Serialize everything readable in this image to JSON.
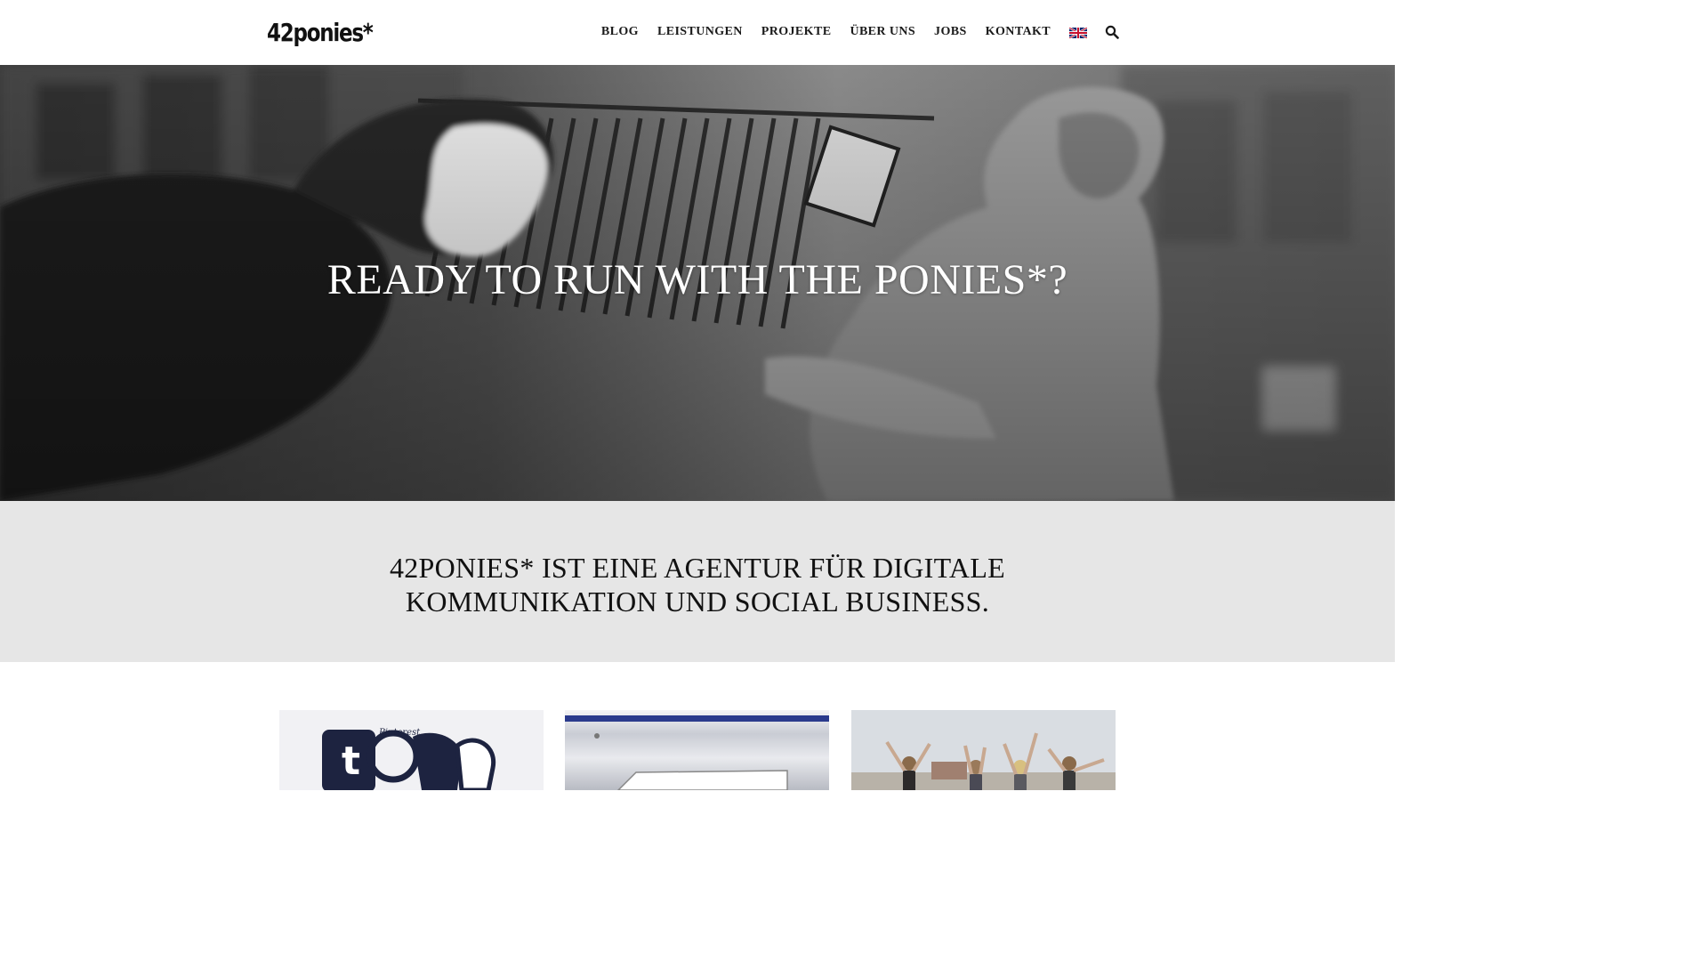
{
  "logo": {
    "text": "42ponies*"
  },
  "nav": {
    "items": [
      {
        "label": "BLOG"
      },
      {
        "label": "LEISTUNGEN"
      },
      {
        "label": "PROJEKTE"
      },
      {
        "label": "ÜBER UNS"
      },
      {
        "label": "JOBS"
      },
      {
        "label": "KONTAKT"
      }
    ],
    "language_icon": "uk-flag-icon",
    "search_icon": "search-icon"
  },
  "hero": {
    "title": "READY TO RUN WITH THE PONIES*?"
  },
  "intro": {
    "line1": "42PONIES* IST EINE AGENTUR FÜR DIGITALE",
    "line2": "KOMMUNIKATION UND SOCIAL BUSINESS."
  },
  "tiles": [
    {
      "name": "social-media-logos-tile",
      "visible_text": "Pinterest"
    },
    {
      "name": "car-detail-tile"
    },
    {
      "name": "team-jumping-tile"
    }
  ],
  "colors": {
    "header_bg": "#ffffff",
    "intro_bg": "#e6e6e6",
    "text": "#1a1a1a",
    "hero_text": "#ffffff"
  }
}
